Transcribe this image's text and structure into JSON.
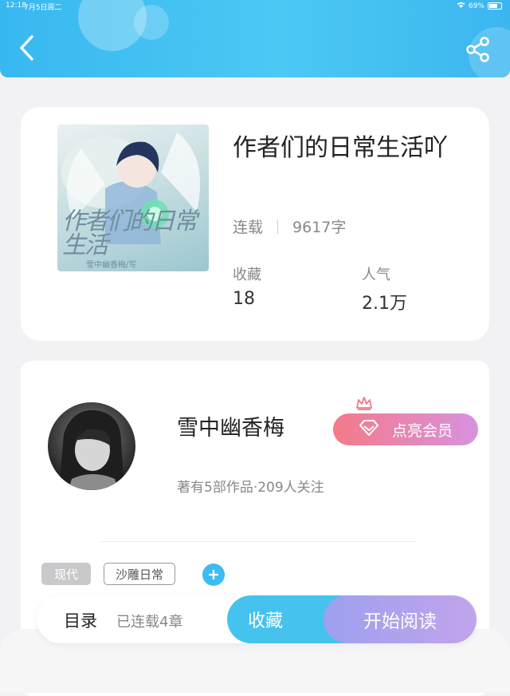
{
  "status_bar": {
    "time": "12:18",
    "date": "7月5日周二",
    "battery": "69%"
  },
  "book": {
    "title": "作者们的日常生活吖",
    "status": "连载",
    "word_count": "9617字",
    "cover": {
      "title": "作者们的日常生活",
      "author": "雪中幽香梅/写"
    },
    "stats": {
      "favorites_label": "收藏",
      "favorites_value": "18",
      "popularity_label": "人气",
      "popularity_value": "2.1万"
    }
  },
  "author": {
    "name": "雪中幽香梅",
    "vip_label": "点亮会员",
    "summary": "著有5部作品·209人关注"
  },
  "tags": [
    "现代",
    "沙雕日常"
  ],
  "bottom_bar": {
    "toc_label": "目录",
    "chapters_label": "已连载4章",
    "collect_label": "收藏",
    "read_label": "开始阅读"
  },
  "colors": {
    "accent": "#45c3ee",
    "vip_start": "#f47a88",
    "vip_end": "#d892e0",
    "read_start": "#9ea0ee",
    "read_end": "#c1a4ec"
  },
  "icons": [
    "back-arrow-icon",
    "share-icon",
    "crown-icon",
    "diamond-icon",
    "plus-icon",
    "wifi-icon",
    "battery-icon"
  ]
}
